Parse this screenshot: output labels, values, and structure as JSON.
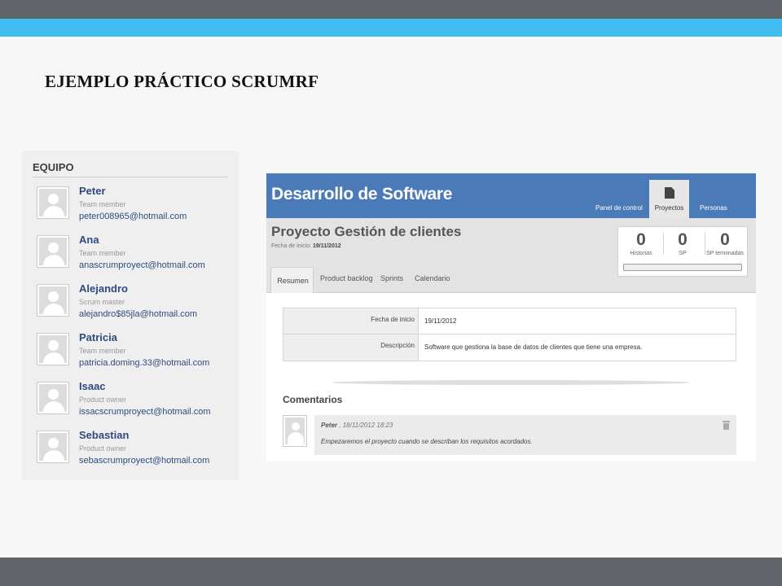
{
  "slide": {
    "title": "EJEMPLO PRÁCTICO SCRUMRF",
    "colors": {
      "top_bar": "#616569",
      "accent_bar": "#3fbcf0",
      "bottom_bar": "#616569"
    }
  },
  "team": {
    "heading": "EQUIPO",
    "members": [
      {
        "name": "Peter",
        "role": "Team member",
        "email": "peter008965@hotmail.com",
        "avatar": "user-placeholder-icon"
      },
      {
        "name": "Ana",
        "role": "Team member",
        "email": "anascrumproyect@hotmail.com",
        "avatar": "user-placeholder-icon"
      },
      {
        "name": "Alejandro",
        "role": "Scrum master",
        "email": "alejandro$85jla@hotmail.com",
        "avatar": "user-placeholder-icon"
      },
      {
        "name": "Patricia",
        "role": "Team member",
        "email": "patricia.doming.33@hotmail.com",
        "avatar": "user-placeholder-icon"
      },
      {
        "name": "Isaac",
        "role": "Product owner",
        "email": "issacscrumproyect@hotmail.com",
        "avatar": "user-placeholder-icon"
      },
      {
        "name": "Sebastian",
        "role": "Product owner",
        "email": "sebascrumproyect@hotmail.com",
        "avatar": "user-placeholder-icon"
      }
    ]
  },
  "app": {
    "brand": "Desarrollo de Software",
    "brand_color": "#4a7ab8",
    "nav": [
      {
        "label": "Panel de control",
        "active": false
      },
      {
        "label": "Proyectos",
        "active": true,
        "icon": "document-icon"
      },
      {
        "label": "Personas",
        "active": false
      }
    ],
    "project": {
      "title": "Proyecto Gestión de clientes",
      "start_label": "Fecha de inicio:",
      "start_value": "19/11/2012"
    },
    "stats": [
      {
        "value": "0",
        "label": "Historias"
      },
      {
        "value": "0",
        "label": "SP"
      },
      {
        "value": "0",
        "label": "SP terminadas"
      }
    ],
    "progress": 0,
    "tabs": [
      {
        "label": "Resumen",
        "active": true
      },
      {
        "label": "Product backlog",
        "active": false
      },
      {
        "label": "Sprints",
        "active": false
      },
      {
        "label": "Calendario",
        "active": false
      }
    ],
    "summary": [
      {
        "key": "Fecha de inicio",
        "value": "19/11/2012"
      },
      {
        "key": "Descripción",
        "value": "Software que gestiona la base de datos de clientes que tiene una empresa."
      }
    ],
    "comments_heading": "Comentarios",
    "comments": [
      {
        "author": "Peter",
        "datetime": ", 18/11/2012 18:23",
        "text": "Empezaremos el proyecto cuando se describan los requisitos acordados."
      }
    ]
  }
}
